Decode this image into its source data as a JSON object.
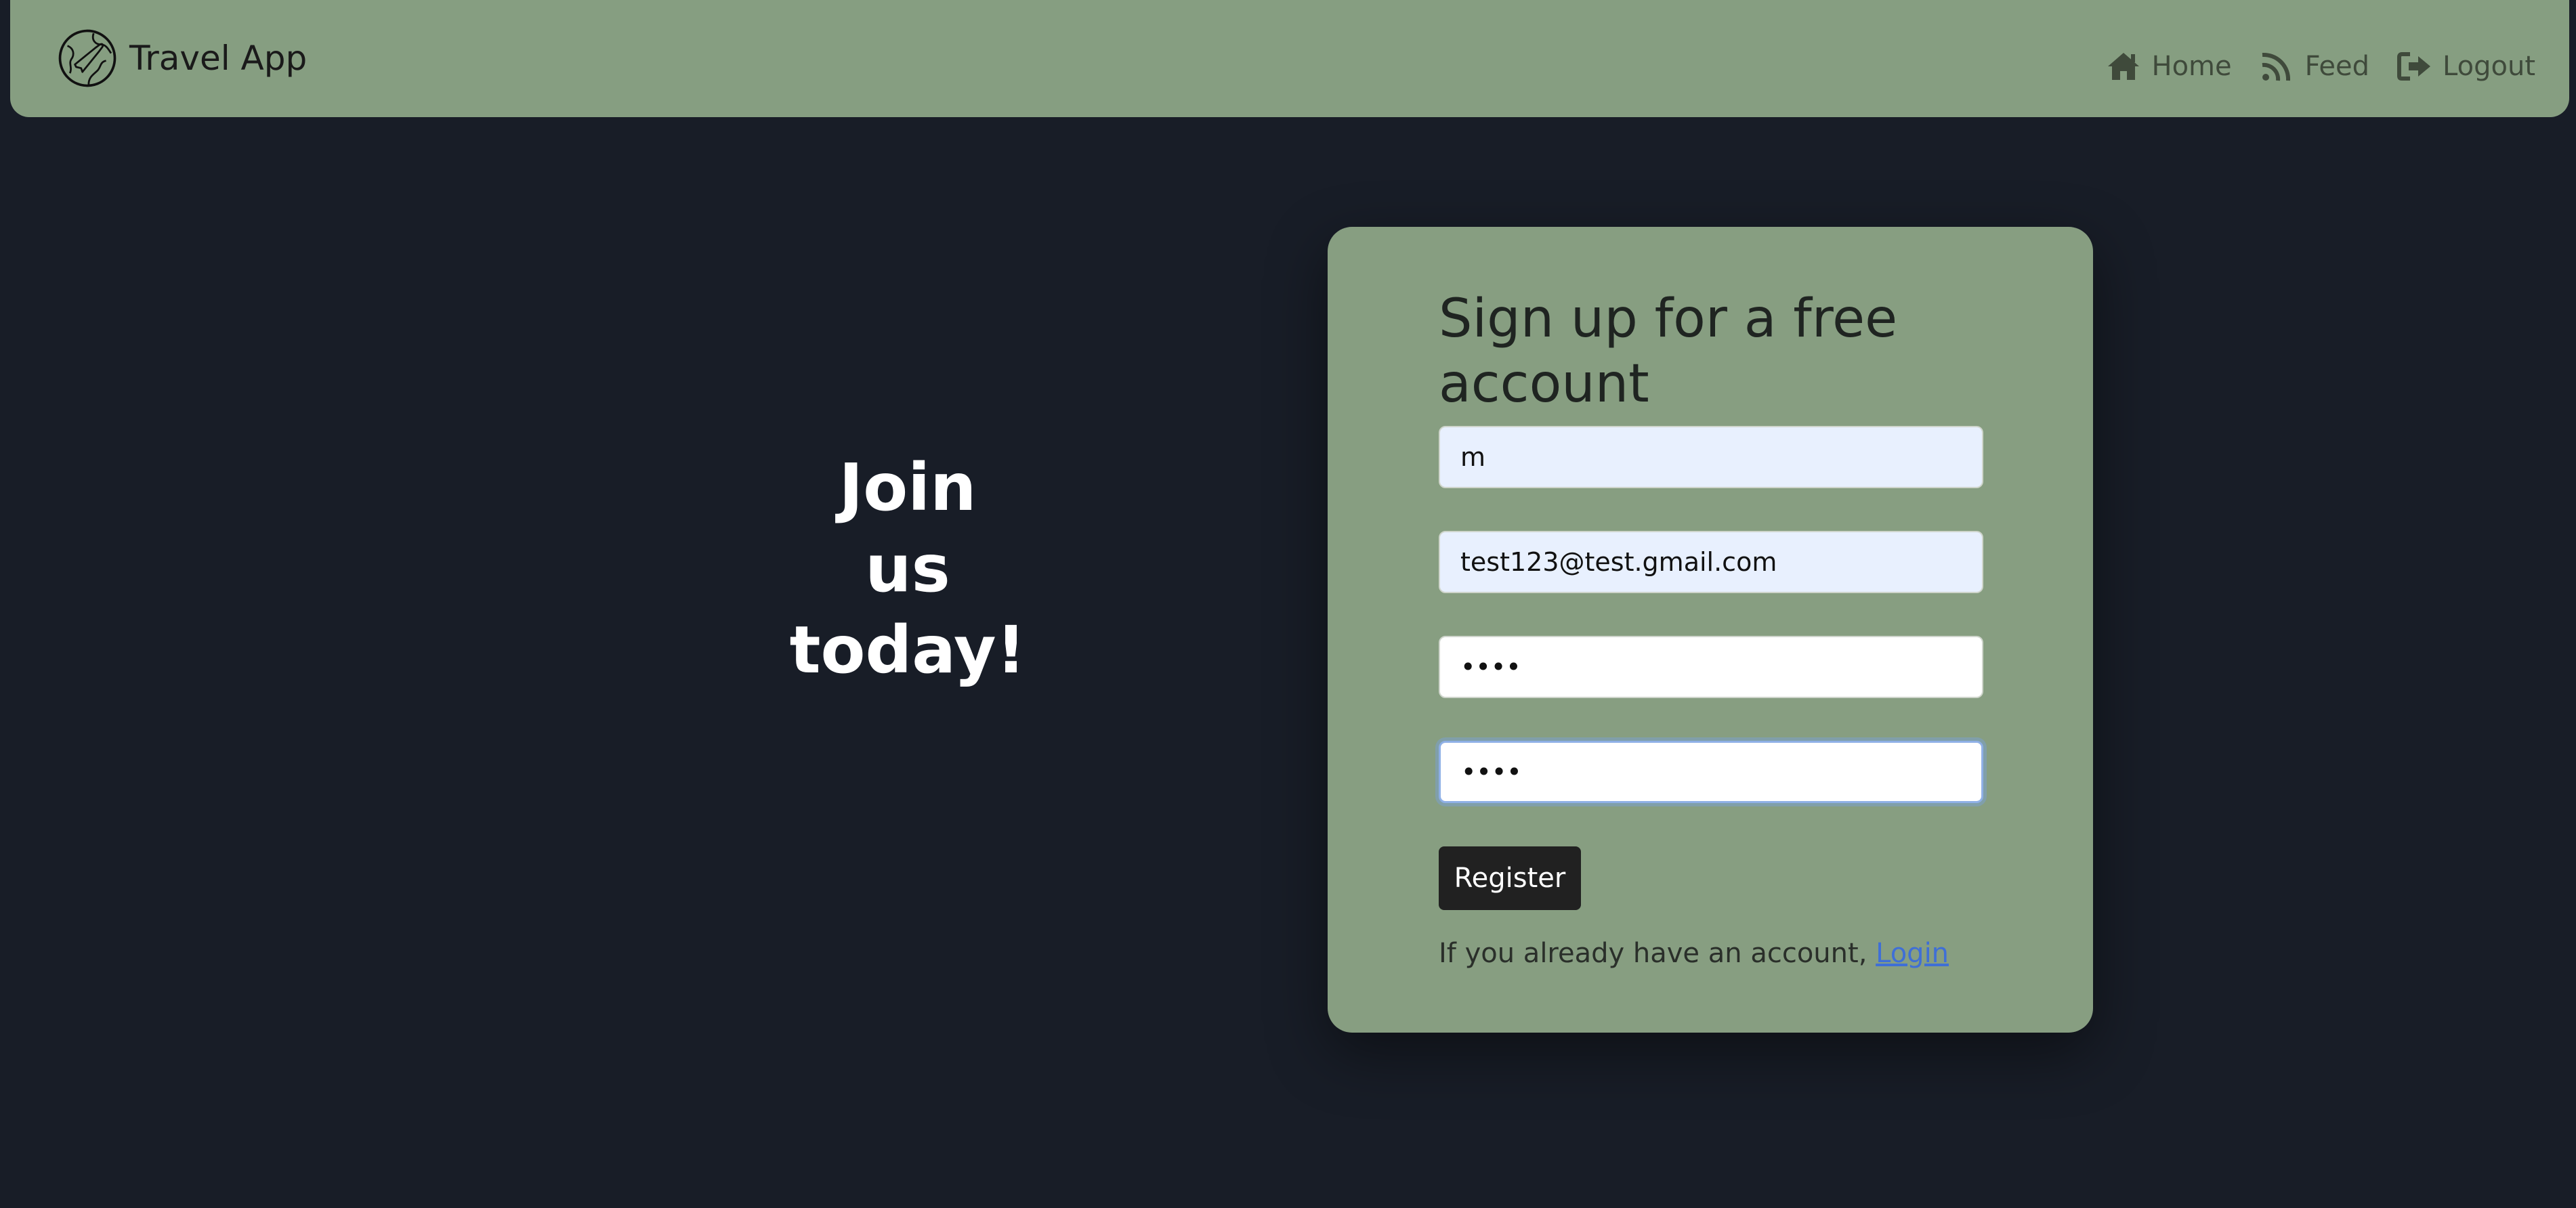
{
  "navbar": {
    "brand": "Travel App",
    "items": [
      {
        "label": "Home",
        "icon": "home-icon"
      },
      {
        "label": "Feed",
        "icon": "rss-feed-icon"
      },
      {
        "label": "Logout",
        "icon": "logout-icon"
      }
    ]
  },
  "hero": {
    "line1": "Join",
    "line2": "us",
    "line3": "today!"
  },
  "form": {
    "title": "Sign up for a free account",
    "username_value": "m",
    "email_value": "test123@test.gmail.com",
    "password_value": "••••",
    "confirm_password_value": "••••",
    "register_label": "Register",
    "login_prompt": "If you already have an account, ",
    "login_link": "Login"
  },
  "colors": {
    "background": "#181d27",
    "accent": "#869e81",
    "button": "#212121",
    "link": "#3f6fd6"
  }
}
